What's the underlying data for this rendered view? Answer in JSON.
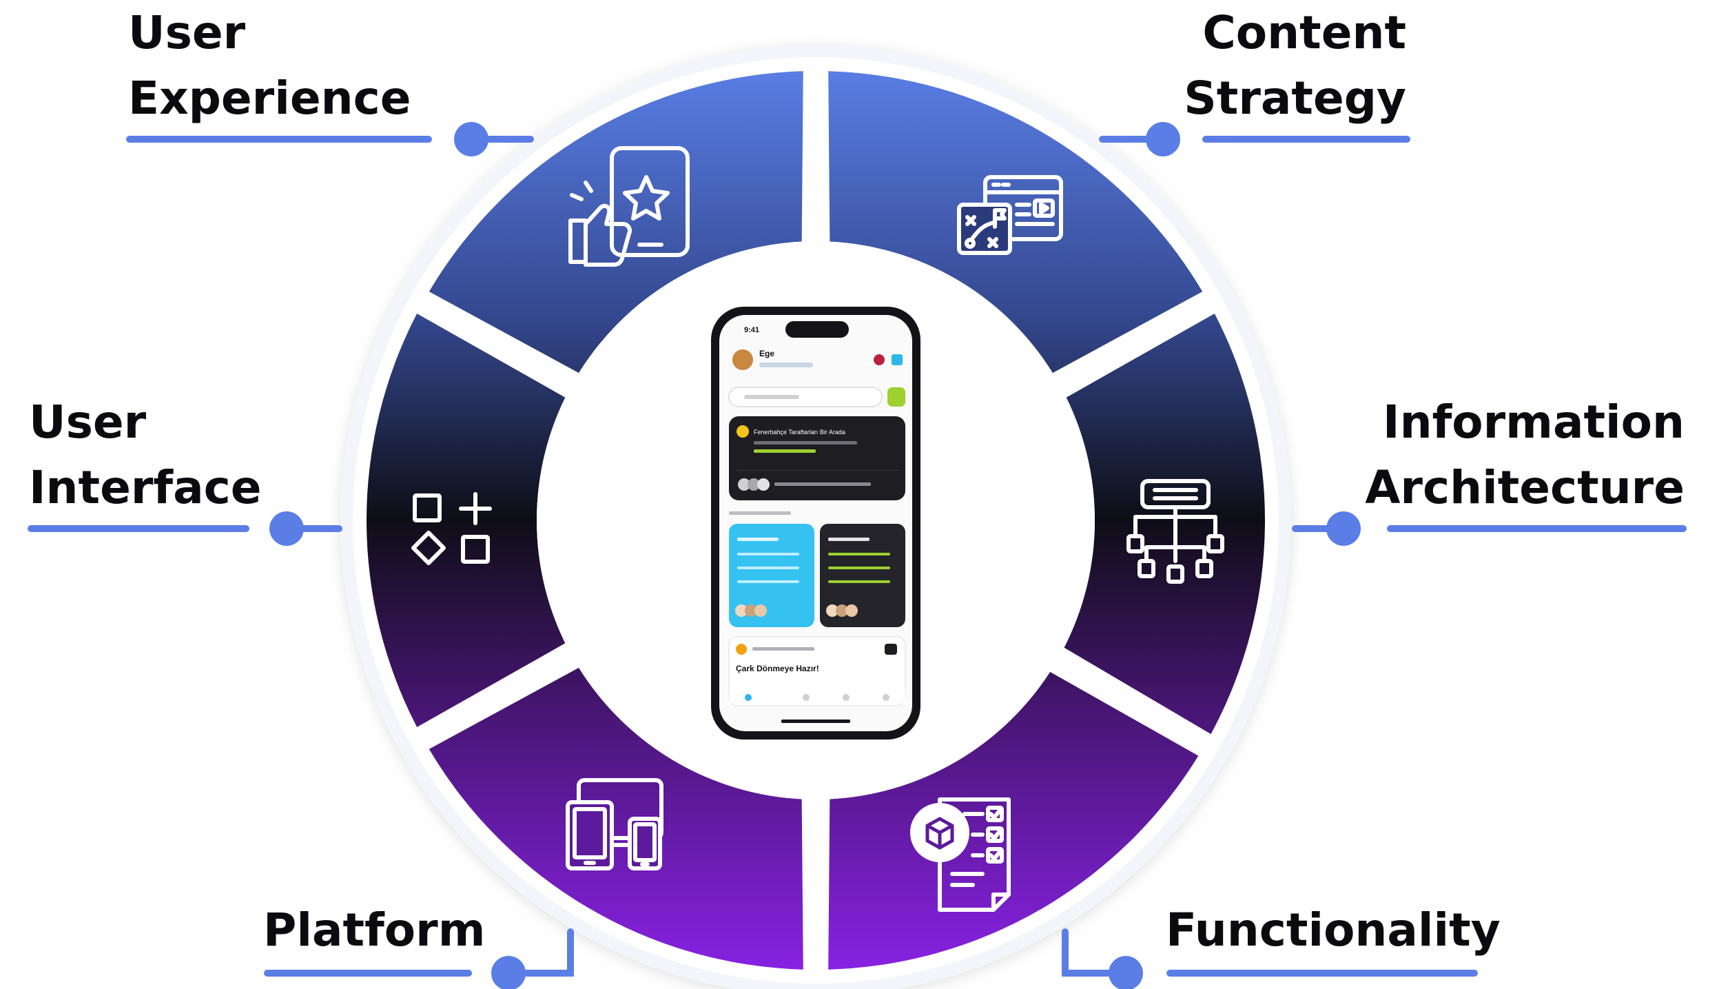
{
  "colors": {
    "accent": "#5a7ee6",
    "ring_top": "#5b80e8",
    "ring_mid": "#0e0e16",
    "ring_bottom": "#8a22e6",
    "label_text": "#0b0b0f"
  },
  "segments": [
    {
      "id": "user-experience",
      "lines": [
        "User",
        "Experience"
      ],
      "icon": "thumbs-up-phone-icon"
    },
    {
      "id": "content-strategy",
      "lines": [
        "Content",
        "Strategy"
      ],
      "icon": "strategy-browser-icon"
    },
    {
      "id": "information-architecture",
      "lines": [
        "Information",
        "Architecture"
      ],
      "icon": "sitemap-icon"
    },
    {
      "id": "functionality",
      "lines": [
        "Functionality"
      ],
      "icon": "checklist-box-icon"
    },
    {
      "id": "platform",
      "lines": [
        "Platform"
      ],
      "icon": "devices-icon"
    },
    {
      "id": "user-interface",
      "lines": [
        "User",
        "Interface"
      ],
      "icon": "ui-shapes-icon"
    }
  ],
  "phone": {
    "status_time": "9:41",
    "user_name": "Ege",
    "card_title": "Fenerbahçe Taraftarları Bir Arada",
    "section_text": "Çark Dönmeye Hazır!"
  }
}
